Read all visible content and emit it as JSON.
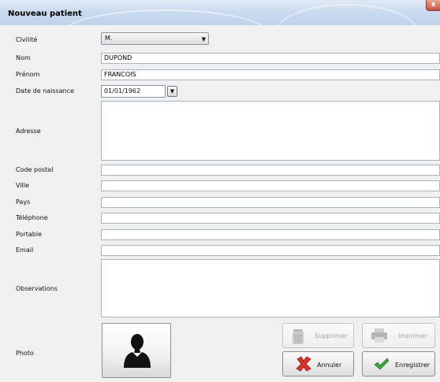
{
  "window": {
    "title": "Nouveau patient",
    "close_label": "x"
  },
  "labels": {
    "civilite": "Civilité",
    "nom": "Nom",
    "prenom": "Prénom",
    "date_naissance": "Date de naissance",
    "adresse": "Adresse",
    "code_postal": "Code postal",
    "ville": "Ville",
    "pays": "Pays",
    "telephone": "Téléphone",
    "portable": "Portable",
    "email": "Email",
    "observations": "Observations",
    "photo": "Photo"
  },
  "values": {
    "civilite": "M.",
    "nom": "DUPOND",
    "prenom": "FRANCOIS",
    "date_naissance": "01/01/1962",
    "code_postal": "",
    "ville": "",
    "pays": "",
    "telephone": "",
    "portable": "",
    "email": ""
  },
  "buttons": {
    "supprimer": "Supprimer",
    "imprimer": "Imprimer",
    "annuler": "Annuler",
    "enregistrer": "Enregistrer"
  },
  "colors": {
    "cancel_icon": "#d9342b",
    "save_icon": "#3aa83a",
    "disabled_text": "#a3a3a3"
  }
}
